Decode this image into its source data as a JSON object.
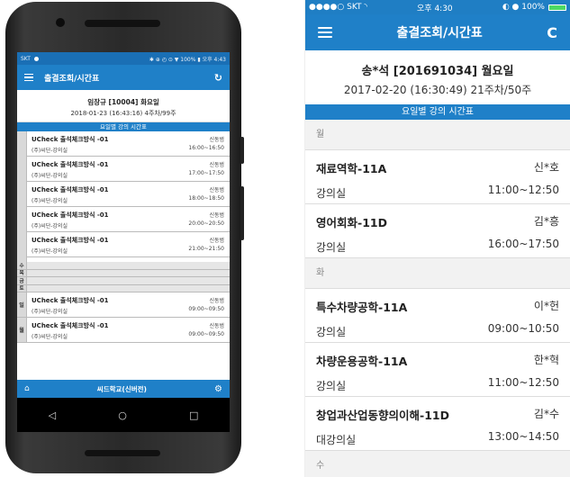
{
  "android": {
    "status": {
      "carrier": "SKT",
      "right_text": "✱ ⊕ ◴ ⊙ ▼ 100% ▮ 오후 4:43"
    },
    "appbar": {
      "title": "출결조회/시간표",
      "refresh_icon": "↻"
    },
    "header": {
      "name": "임장규 [10004] 화요일",
      "date": "2018-01-23 (16:43:16) 4주차/99주"
    },
    "section_title": "요일별 강의 시간표",
    "rows": [
      {
        "course": "UCheck 출석체크방식 -01",
        "room": "(주)씨단-강의실",
        "prof": "신동범",
        "time": "16:00~16:50"
      },
      {
        "course": "UCheck 출석체크방식 -01",
        "room": "(주)씨단-강의실",
        "prof": "신동범",
        "time": "17:00~17:50"
      },
      {
        "course": "UCheck 출석체크방식 -01",
        "room": "(주)씨단-강의실",
        "prof": "신동범",
        "time": "18:00~18:50"
      },
      {
        "course": "UCheck 출석체크방식 -01",
        "room": "(주)씨단-강의실",
        "prof": "신동범",
        "time": "20:00~20:50"
      },
      {
        "course": "UCheck 출석체크방식 -01",
        "room": "(주)씨단-강의실",
        "prof": "신동범",
        "time": "21:00~21:50"
      }
    ],
    "empty_days": [
      "수",
      "목",
      "금",
      "토"
    ],
    "sun_row": {
      "day": "일",
      "course": "UCheck 출석체크방식 -01",
      "room": "(주)씨단-강의실",
      "prof": "신동범",
      "time": "09:00~09:50"
    },
    "mon_row": {
      "day": "월",
      "course": "UCheck 출석체크방식 -01",
      "room": "(주)씨단-강의실",
      "prof": "신동범",
      "time": "09:00~09:50"
    },
    "bottom": {
      "title": "씨드학교(신버전)",
      "home_icon": "⌂",
      "settings_icon": "⚙"
    },
    "nav": {
      "back": "◁",
      "home": "○",
      "recents": "□"
    }
  },
  "ios": {
    "status": {
      "carrier": "●●●●○ SKT ◝",
      "time": "오후 4:30",
      "right": "◐ ● 100%"
    },
    "appbar": {
      "title": "출결조회/시간표",
      "refresh_icon": "C"
    },
    "header": {
      "name": "송*석 [201691034] 월요일",
      "date": "2017-02-20 (16:30:49) 21주차/50주"
    },
    "section_title": "요일별 강의 시간표",
    "day_mon": "월",
    "mon_rows": [
      {
        "course": "재료역학-11A",
        "room": "강의실",
        "prof": "신*호",
        "time": "11:00~12:50"
      },
      {
        "course": "영어회화-11D",
        "room": "강의실",
        "prof": "김*흥",
        "time": "16:00~17:50"
      }
    ],
    "day_tue": "화",
    "tue_rows": [
      {
        "course": "특수차량공학-11A",
        "room": "강의실",
        "prof": "이*헌",
        "time": "09:00~10:50"
      },
      {
        "course": "차량운용공학-11A",
        "room": "강의실",
        "prof": "한*혁",
        "time": "11:00~12:50"
      },
      {
        "course": "창업과산업동향의이해-11D",
        "room": "대강의실",
        "prof": "김*수",
        "time": "13:00~14:50"
      }
    ],
    "day_wed": "수"
  }
}
